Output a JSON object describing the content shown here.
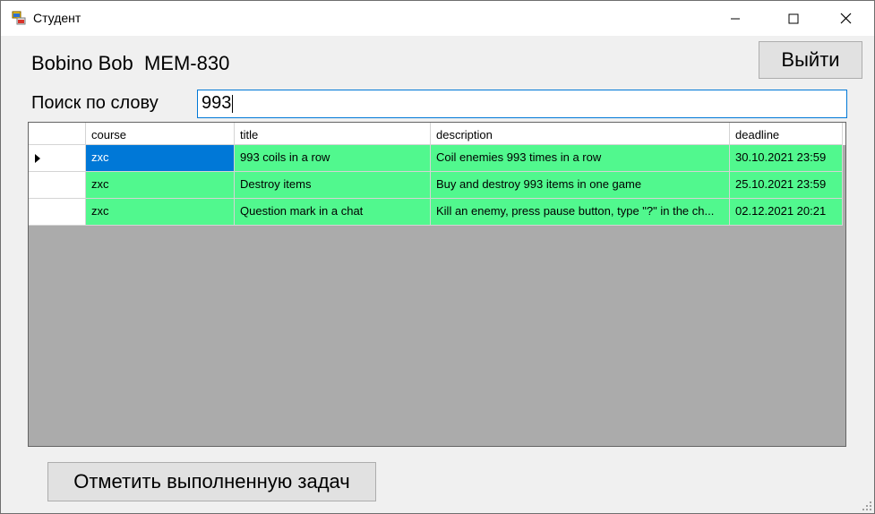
{
  "window": {
    "title": "Студент"
  },
  "header": {
    "user_label": "Bobino Bob  MEM-830",
    "exit_label": "Выйти"
  },
  "search": {
    "label": "Поиск по слову",
    "value": "993"
  },
  "grid": {
    "columns": [
      "course",
      "title",
      "description",
      "deadline"
    ],
    "rows": [
      {
        "course": "zxc",
        "title": "993 coils in a row",
        "description": "Coil enemies 993 times in a row",
        "deadline": "30.10.2021 23:59"
      },
      {
        "course": "zxc",
        "title": "Destroy items",
        "description": "Buy and destroy 993 items in one game",
        "deadline": "25.10.2021 23:59"
      },
      {
        "course": "zxc",
        "title": "Question mark in a chat",
        "description": "Kill an enemy, press pause button, type \"?\" in the ch...",
        "deadline": "02.12.2021 20:21"
      }
    ],
    "row_color": "#51f88e",
    "selection_color": "#0078d7"
  },
  "footer": {
    "mark_done_label": "Отметить выполненную задач"
  }
}
